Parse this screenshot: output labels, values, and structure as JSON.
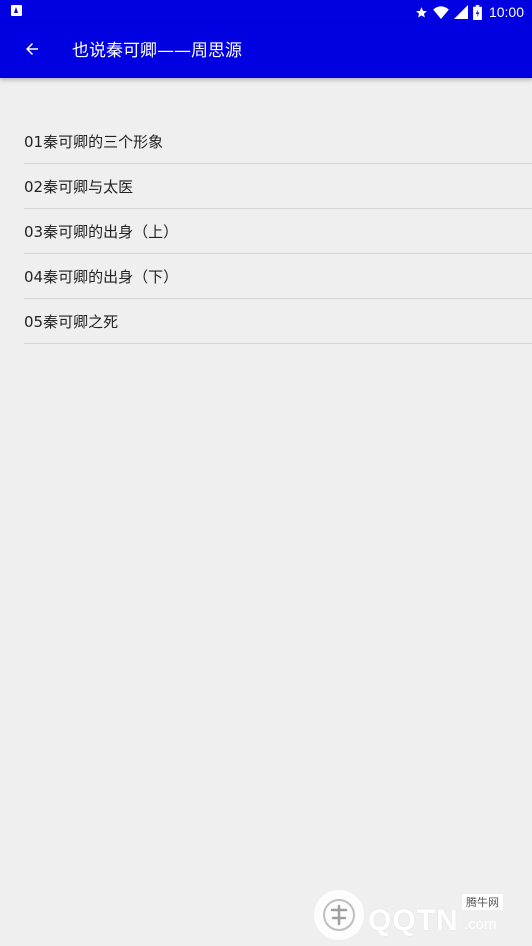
{
  "status_bar": {
    "time": "10:00",
    "icons": [
      "notification-icon",
      "star-icon",
      "wifi-icon",
      "signal-icon",
      "battery-icon"
    ]
  },
  "toolbar": {
    "back_icon": "arrow-left-icon",
    "title": "也说秦可卿——周思源"
  },
  "chapters": [
    {
      "label": "01秦可卿的三个形象"
    },
    {
      "label": "02秦可卿与太医"
    },
    {
      "label": "03秦可卿的出身（上）"
    },
    {
      "label": "04秦可卿的出身（下）"
    },
    {
      "label": "05秦可卿之死"
    }
  ],
  "watermark": {
    "text": "QQTN",
    "suffix": ".com",
    "tag": "腾牛网"
  },
  "colors": {
    "primary": "#0000e0",
    "background": "#efefef",
    "text": "#222222",
    "divider": "#d6d6d6"
  }
}
